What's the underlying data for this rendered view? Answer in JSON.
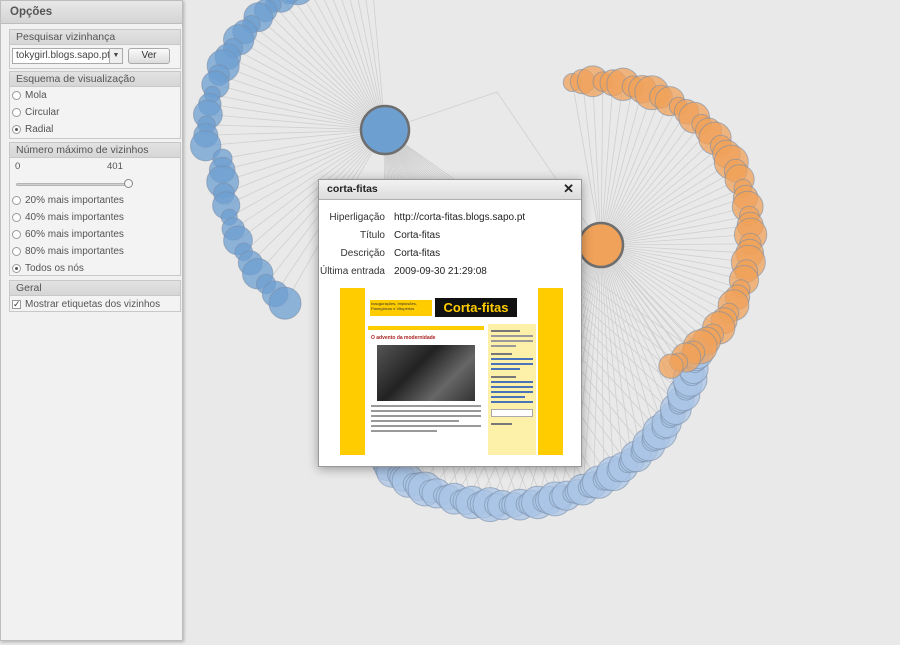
{
  "panel": {
    "title": "Opções",
    "neighborhood": {
      "heading": "Pesquisar vizinhança",
      "selected_blog": "tokygirl.blogs.sapo.pt",
      "view_button": "Ver"
    },
    "layout": {
      "heading": "Esquema de visualização",
      "options": [
        {
          "label": "Mola",
          "checked": false
        },
        {
          "label": "Circular",
          "checked": false
        },
        {
          "label": "Radial",
          "checked": true
        }
      ]
    },
    "max_neighbors": {
      "heading": "Número máximo de vizinhos",
      "min_label": "0",
      "max_label": "401",
      "slider_value": 1.0,
      "options": [
        {
          "label": "20% mais importantes",
          "checked": false
        },
        {
          "label": "40% mais importantes",
          "checked": false
        },
        {
          "label": "60% mais importantes",
          "checked": false
        },
        {
          "label": "80% mais importantes",
          "checked": false
        },
        {
          "label": "Todos os nós",
          "checked": true
        }
      ]
    },
    "general": {
      "heading": "Geral",
      "show_labels": {
        "label": "Mostrar etiquetas dos vizinhos",
        "checked": true
      }
    }
  },
  "dialog": {
    "title": "corta-fitas",
    "close": "✕",
    "fields": [
      {
        "label": "Hiperligação",
        "value": "http://corta-fitas.blogs.sapo.pt"
      },
      {
        "label": "Título",
        "value": "Corta-fitas"
      },
      {
        "label": "Descrição",
        "value": "Corta-fitas"
      },
      {
        "label": "Última entrada",
        "value": "2009-09-30 21:29:08"
      }
    ],
    "preview": {
      "logo": "Corta-fitas",
      "tagline": "Inaugurações, Implosões, Panegíricos e Vitupérios",
      "post_title": "O advento da modernidade"
    }
  },
  "colors": {
    "blue": "#6d9fd1",
    "orange": "#f0a25a",
    "light_blue": "#a9c4e6",
    "yellow": "#ffcc00"
  }
}
